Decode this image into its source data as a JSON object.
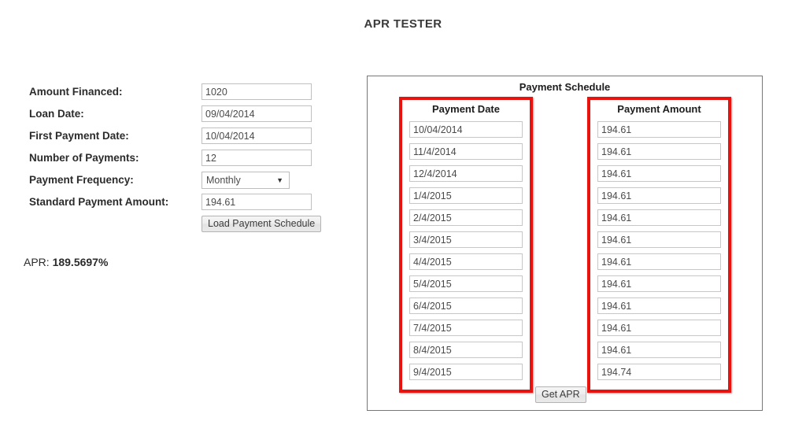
{
  "page": {
    "title": "APR TESTER"
  },
  "form": {
    "fields": [
      {
        "label": "Amount Financed:",
        "value": "1020",
        "type": "text"
      },
      {
        "label": "Loan Date:",
        "value": "09/04/2014",
        "type": "text"
      },
      {
        "label": "First Payment Date:",
        "value": "10/04/2014",
        "type": "text"
      },
      {
        "label": "Number of Payments:",
        "value": "12",
        "type": "text"
      },
      {
        "label": "Payment Frequency:",
        "value": "Monthly",
        "type": "select"
      },
      {
        "label": "Standard Payment Amount:",
        "value": "194.61",
        "type": "text"
      }
    ],
    "frequency_selected": "Monthly",
    "frequency_arrow": "▼",
    "load_button_label": "Load Payment Schedule"
  },
  "result": {
    "apr_label": "APR:",
    "apr_value": "189.5697%"
  },
  "schedule": {
    "panel_title": "Payment Schedule",
    "date_header": "Payment Date",
    "amount_header": "Payment Amount",
    "get_apr_label": "Get APR",
    "rows": [
      {
        "date": "10/04/2014",
        "amount": "194.61"
      },
      {
        "date": "11/4/2014",
        "amount": "194.61"
      },
      {
        "date": "12/4/2014",
        "amount": "194.61"
      },
      {
        "date": "1/4/2015",
        "amount": "194.61"
      },
      {
        "date": "2/4/2015",
        "amount": "194.61"
      },
      {
        "date": "3/4/2015",
        "amount": "194.61"
      },
      {
        "date": "4/4/2015",
        "amount": "194.61"
      },
      {
        "date": "5/4/2015",
        "amount": "194.61"
      },
      {
        "date": "6/4/2015",
        "amount": "194.61"
      },
      {
        "date": "7/4/2015",
        "amount": "194.61"
      },
      {
        "date": "8/4/2015",
        "amount": "194.61"
      },
      {
        "date": "9/4/2015",
        "amount": "194.74"
      }
    ]
  },
  "annotations": {
    "highlight_color": "#e8120e",
    "boxes": [
      "payment-date-column",
      "payment-amount-column"
    ]
  }
}
